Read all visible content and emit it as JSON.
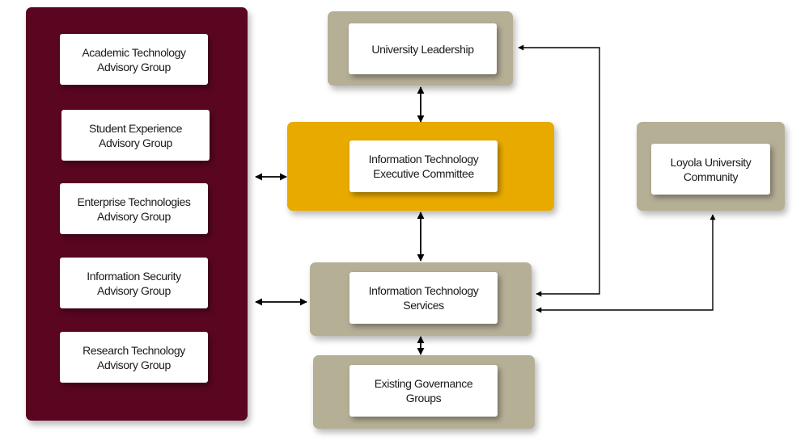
{
  "diagram": {
    "advisory_panel": {
      "color": "#5a0621",
      "groups": [
        {
          "label": "Academic Technology\nAdvisory Group"
        },
        {
          "label": "Student Experience\nAdvisory Group"
        },
        {
          "label": "Enterprise Technologies\nAdvisory Group"
        },
        {
          "label": "Information Security\nAdvisory Group"
        },
        {
          "label": "Research Technology\nAdvisory Group"
        }
      ]
    },
    "university_leadership": {
      "label": "University Leadership",
      "color": "#b5af96"
    },
    "it_executive_committee": {
      "label": "Information Technology\nExecutive Committee",
      "color": "#e9aa00"
    },
    "it_services": {
      "label": "Information Technology\nServices",
      "color": "#b5af96"
    },
    "existing_governance": {
      "label": "Existing Governance\nGroups",
      "color": "#b5af96"
    },
    "loyola_community": {
      "label": "Loyola University\nCommunity",
      "color": "#b5af96"
    },
    "connections": [
      {
        "from": "University Leadership",
        "to": "Information Technology Executive Committee",
        "direction": "bidirectional"
      },
      {
        "from": "Advisory Groups",
        "to": "Information Technology Executive Committee",
        "direction": "bidirectional"
      },
      {
        "from": "Information Technology Executive Committee",
        "to": "Information Technology Services",
        "direction": "bidirectional"
      },
      {
        "from": "Advisory Groups",
        "to": "Information Technology Services",
        "direction": "bidirectional"
      },
      {
        "from": "Information Technology Services",
        "to": "Existing Governance Groups",
        "direction": "bidirectional"
      },
      {
        "from": "Information Technology Services",
        "to": "University Leadership",
        "direction": "bidirectional"
      },
      {
        "from": "Information Technology Services",
        "to": "Loyola University Community",
        "direction": "bidirectional"
      }
    ]
  }
}
